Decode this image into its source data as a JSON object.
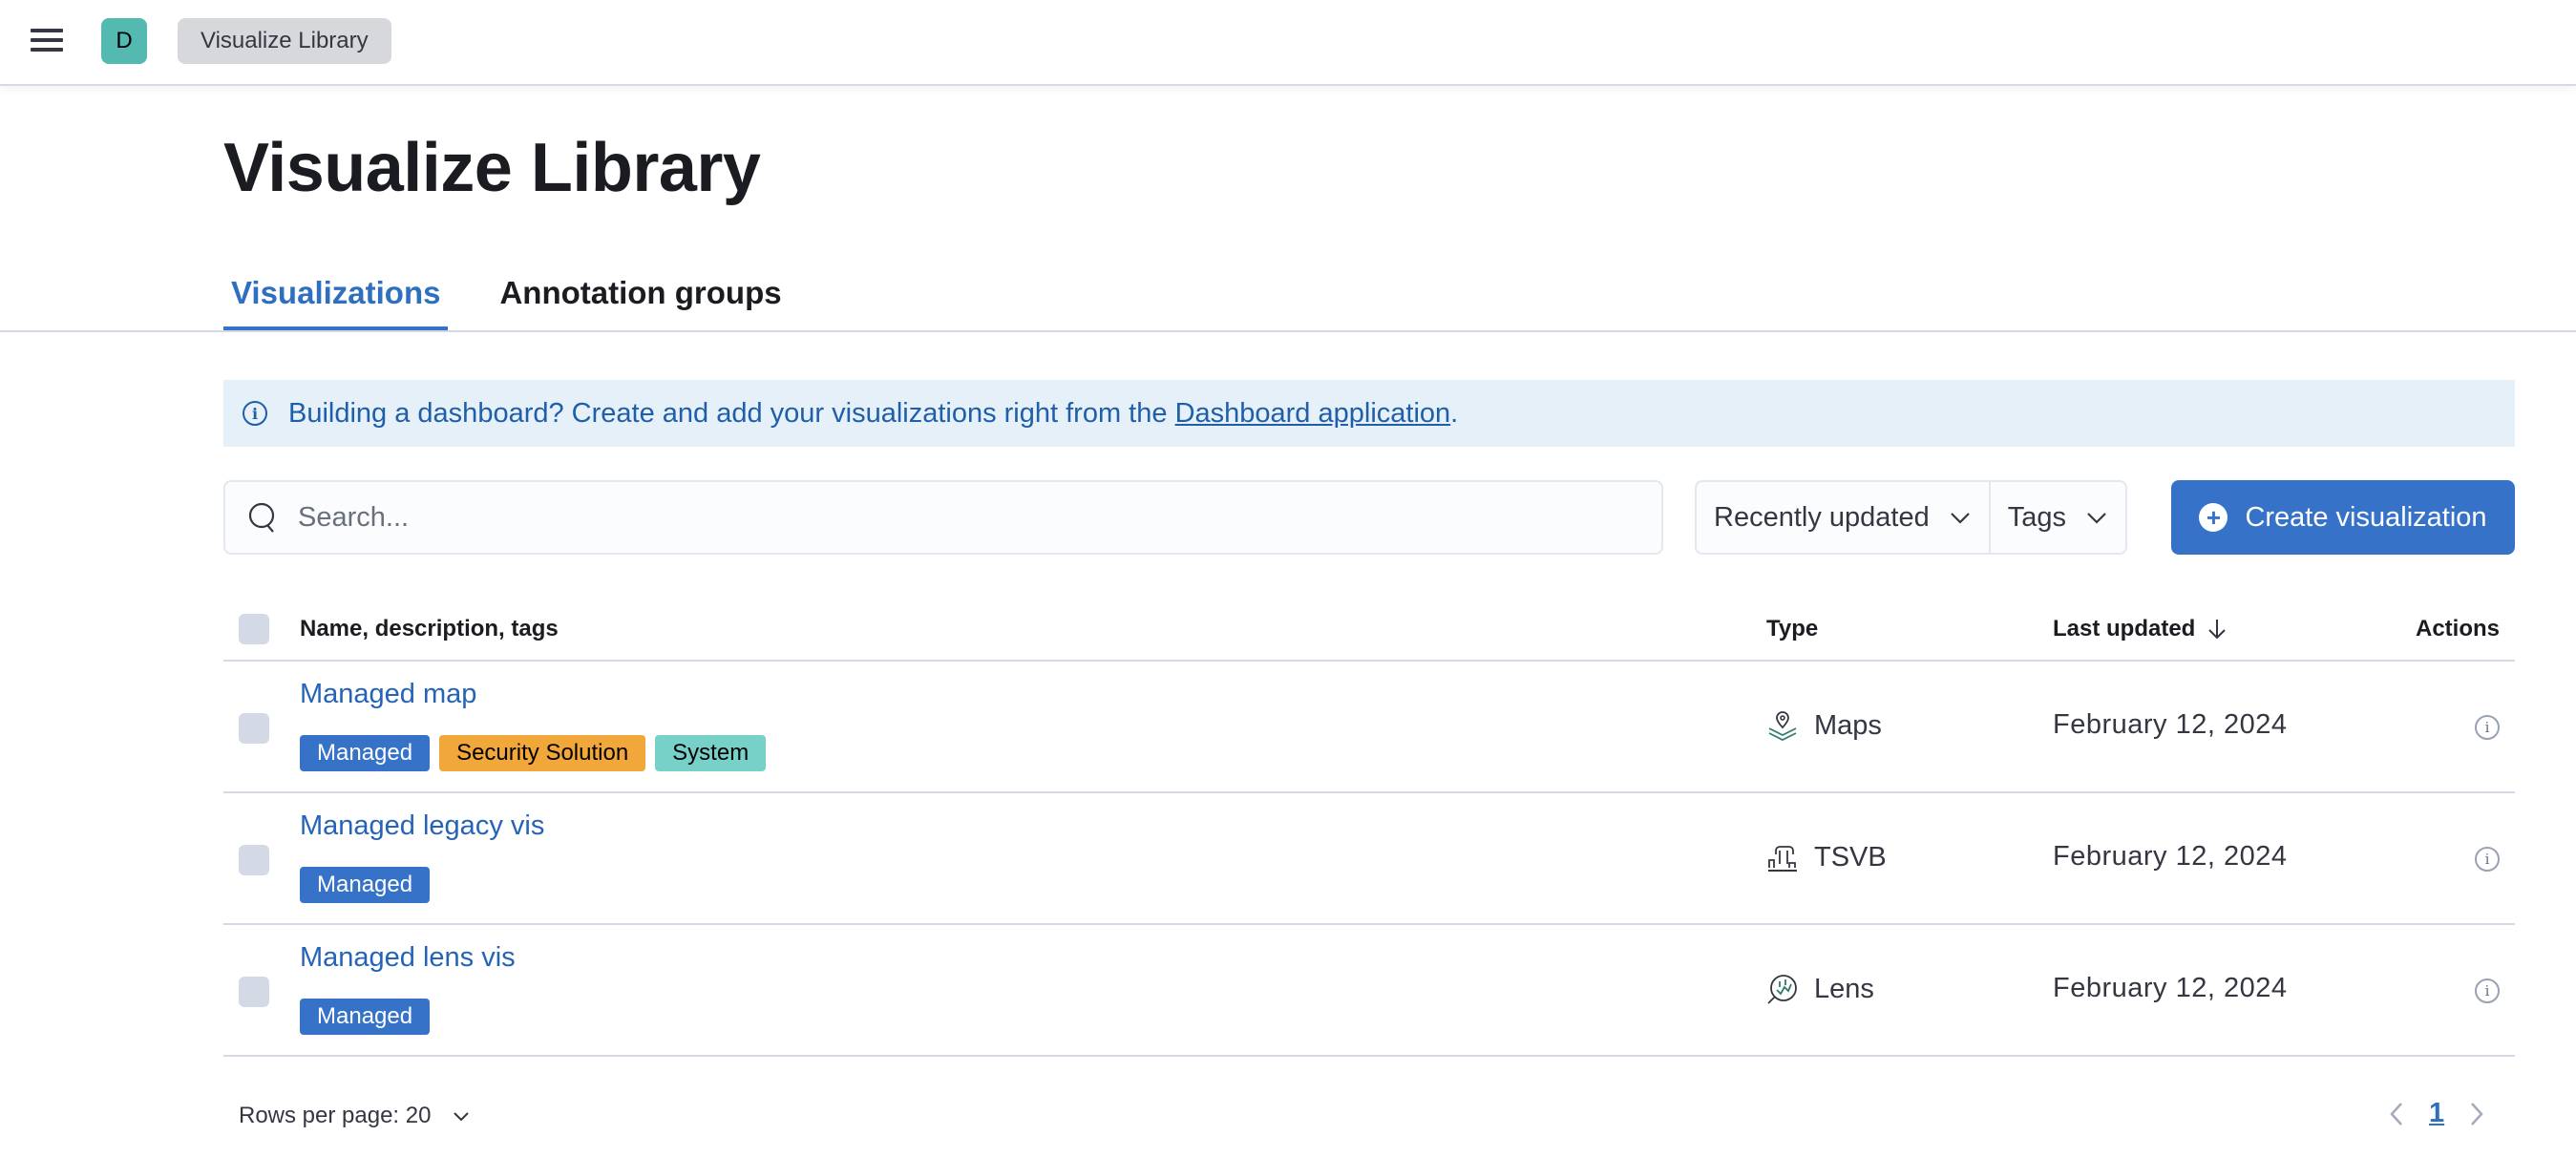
{
  "header": {
    "avatar_initial": "D",
    "breadcrumb": "Visualize Library"
  },
  "page": {
    "title": "Visualize Library",
    "tabs": [
      {
        "label": "Visualizations",
        "active": true
      },
      {
        "label": "Annotation groups",
        "active": false
      }
    ]
  },
  "callout": {
    "text": "Building a dashboard? Create and add your visualizations right from the ",
    "link": "Dashboard application",
    "suffix": "."
  },
  "toolbar": {
    "search_placeholder": "Search...",
    "search_value": "",
    "sort_label": "Recently updated",
    "tags_label": "Tags",
    "create_label": "Create visualization"
  },
  "table": {
    "columns": {
      "name": "Name, description, tags",
      "type": "Type",
      "updated": "Last updated",
      "actions": "Actions"
    },
    "rows": [
      {
        "title": "Managed map",
        "tags": [
          {
            "label": "Managed",
            "bg": "#3673c8",
            "fg": "#ffffff"
          },
          {
            "label": "Security Solution",
            "bg": "#f1a73a",
            "fg": "#000000"
          },
          {
            "label": "System",
            "bg": "#77d1c9",
            "fg": "#000000"
          }
        ],
        "type": "Maps",
        "type_icon": "maps-icon",
        "updated": "February 12, 2024"
      },
      {
        "title": "Managed legacy vis",
        "tags": [
          {
            "label": "Managed",
            "bg": "#3673c8",
            "fg": "#ffffff"
          }
        ],
        "type": "TSVB",
        "type_icon": "tsvb-icon",
        "updated": "February 12, 2024"
      },
      {
        "title": "Managed lens vis",
        "tags": [
          {
            "label": "Managed",
            "bg": "#3673c8",
            "fg": "#ffffff"
          }
        ],
        "type": "Lens",
        "type_icon": "lens-icon",
        "updated": "February 12, 2024"
      }
    ]
  },
  "pagination": {
    "rows_per_page": "Rows per page: 20",
    "current_page": "1"
  },
  "colors": {
    "primary": "#3673c8",
    "link": "#2563b8",
    "callout_bg": "#e6f0f8"
  }
}
